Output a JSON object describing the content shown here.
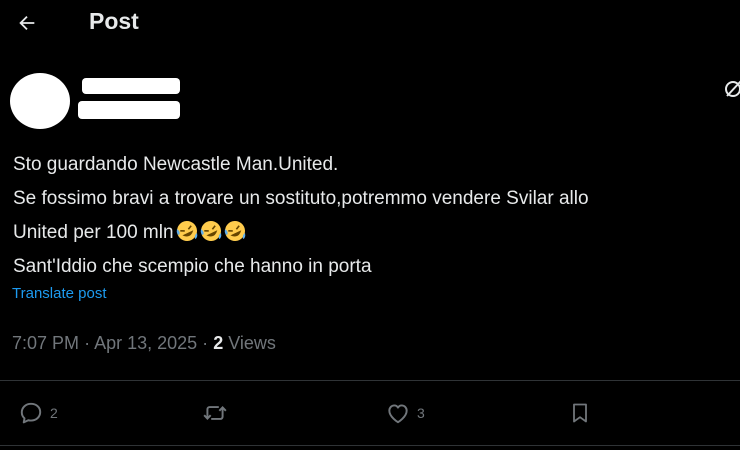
{
  "header": {
    "title": "Post",
    "back_icon": "arrow-left-icon"
  },
  "post": {
    "lines": [
      "Sto guardando Newcastle Man.United.",
      "Se fossimo bravi a trovare un sostituto,potremmo vendere Svilar allo",
      "United per 100 mln",
      "Sant'Iddio che scempio che hanno in porta"
    ],
    "emoji": "rolling-on-the-floor-laughing-emoji",
    "emoji_count": 3,
    "translate_label": "Translate post",
    "time": "7:07 PM",
    "separator": "·",
    "date": "Apr 13, 2025",
    "views_count": "2",
    "views_label": "Views"
  },
  "actions": {
    "reply_count": "2",
    "like_count": "3"
  },
  "colors": {
    "background": "#000000",
    "text": "#e7e9ea",
    "muted": "#71767b",
    "link": "#1d9bf0",
    "divider": "#2f3336"
  }
}
